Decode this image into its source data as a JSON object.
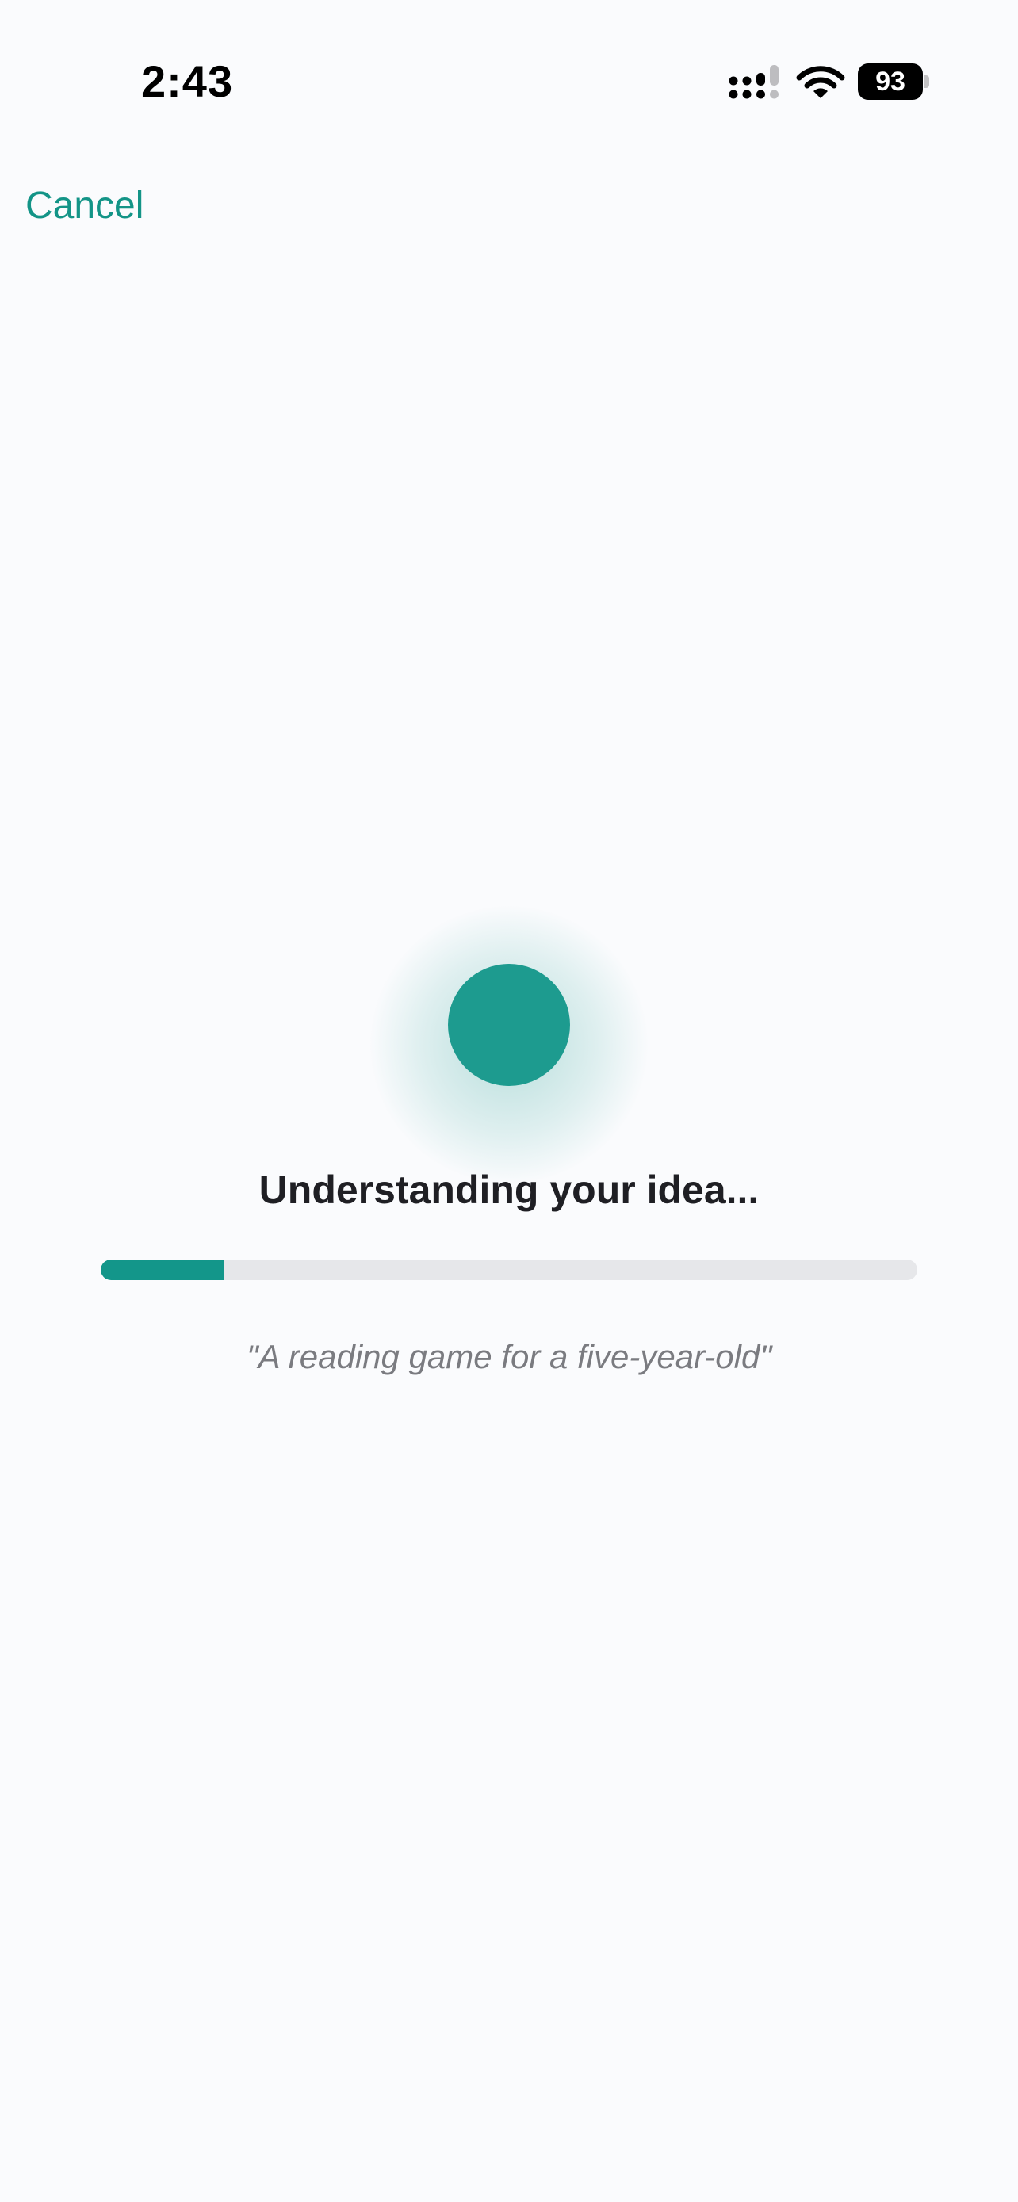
{
  "status_bar": {
    "time": "2:43",
    "battery_level": "93",
    "cellular_icon": "cellular-signal-icon",
    "wifi_icon": "wifi-icon",
    "battery_icon": "battery-icon"
  },
  "nav": {
    "cancel_label": "Cancel"
  },
  "loading": {
    "indicator_icon": "loading-orb",
    "title": "Understanding your idea...",
    "progress": 0.15,
    "quote": "\"A reading game for a five-year-old\""
  },
  "colors": {
    "accent": "#1d9b8f",
    "progress_fill": "#13968a",
    "progress_track": "#e6e7ea",
    "background": "#fafbfd",
    "title_text": "#1f1f24",
    "quote_text": "#7a7b80"
  }
}
